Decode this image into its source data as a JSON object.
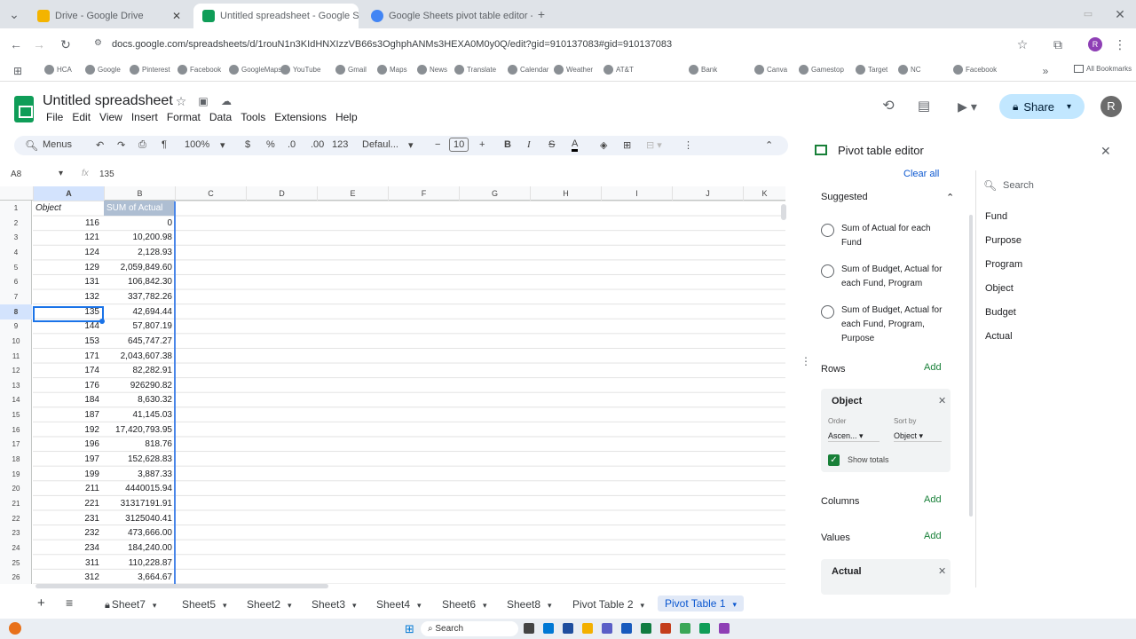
{
  "browser": {
    "tabs": [
      {
        "label": "Drive - Google Drive"
      },
      {
        "label": "Untitled spreadsheet - Google Sheets"
      },
      {
        "label": "Google Sheets pivot table editor - Google Search"
      }
    ],
    "url": "docs.google.com/spreadsheets/d/1rouN1n3KIdHNXIzzVB66s3OghphANMs3HEXA0M0y0Q/edit?gid=910137083#gid=910137083",
    "bookmarks": [
      "HCA",
      "Google",
      "Pinterest",
      "Facebook",
      "GoogleMaps",
      "YouTube",
      "Gmail",
      "Maps",
      "News",
      "Translate",
      "Calendar",
      "Weather",
      "AT&T",
      "Bank",
      "Canva",
      "Gamestop",
      "Target",
      "NC",
      "Facebook"
    ],
    "all_bookmarks": "All Bookmarks"
  },
  "doc": {
    "title": "Untitled spreadsheet",
    "menus": [
      "File",
      "Edit",
      "View",
      "Insert",
      "Format",
      "Data",
      "Tools",
      "Extensions",
      "Help"
    ],
    "share_label": "Share",
    "avatar": "R"
  },
  "toolbar": {
    "menus_label": "Menus",
    "zoom": "100%",
    "currency": "$",
    "percent": "%",
    "dec_decrease": ".0",
    "dec_increase": ".00",
    "number_format": "123",
    "font": "Defaul...",
    "font_size": "10",
    "bold": "B",
    "italic": "I"
  },
  "formula": {
    "cell_ref": "A8",
    "value": "135"
  },
  "columns": [
    "A",
    "B",
    "C",
    "D",
    "E",
    "F",
    "G",
    "H",
    "I",
    "J",
    "K"
  ],
  "rows": [
    {
      "n": "1",
      "a": "Object",
      "b": "SUM of Actual"
    },
    {
      "n": "2",
      "a": "116",
      "b": "0"
    },
    {
      "n": "3",
      "a": "121",
      "b": "10,200.98"
    },
    {
      "n": "4",
      "a": "124",
      "b": "2,128.93"
    },
    {
      "n": "5",
      "a": "129",
      "b": "2,059,849.60"
    },
    {
      "n": "6",
      "a": "131",
      "b": "106,842.30"
    },
    {
      "n": "7",
      "a": "132",
      "b": "337,782.26"
    },
    {
      "n": "8",
      "a": "135",
      "b": "42,694.44"
    },
    {
      "n": "9",
      "a": "144",
      "b": "57,807.19"
    },
    {
      "n": "10",
      "a": "153",
      "b": "645,747.27"
    },
    {
      "n": "11",
      "a": "171",
      "b": "2,043,607.38"
    },
    {
      "n": "12",
      "a": "174",
      "b": "82,282.91"
    },
    {
      "n": "13",
      "a": "176",
      "b": "926290.82"
    },
    {
      "n": "14",
      "a": "184",
      "b": "8,630.32"
    },
    {
      "n": "15",
      "a": "187",
      "b": "41,145.03"
    },
    {
      "n": "16",
      "a": "192",
      "b": "17,420,793.95"
    },
    {
      "n": "17",
      "a": "196",
      "b": "818.76"
    },
    {
      "n": "18",
      "a": "197",
      "b": "152,628.83"
    },
    {
      "n": "19",
      "a": "199",
      "b": "3,887.33"
    },
    {
      "n": "20",
      "a": "211",
      "b": "4440015.94"
    },
    {
      "n": "21",
      "a": "221",
      "b": "31317191.91"
    },
    {
      "n": "22",
      "a": "231",
      "b": "3125040.41"
    },
    {
      "n": "23",
      "a": "232",
      "b": "473,666.00"
    },
    {
      "n": "24",
      "a": "234",
      "b": "184,240.00"
    },
    {
      "n": "25",
      "a": "311",
      "b": "110,228.87"
    },
    {
      "n": "26",
      "a": "312",
      "b": "3,664.67"
    }
  ],
  "sheets": [
    "Sheet7",
    "Sheet5",
    "Sheet2",
    "Sheet3",
    "Sheet4",
    "Sheet6",
    "Sheet8",
    "Pivot Table 2",
    "Pivot Table 1"
  ],
  "pivot": {
    "title": "Pivot table editor",
    "clear_all": "Clear all",
    "suggested": "Suggested",
    "suggestions": [
      "Sum of Actual for each Fund",
      "Sum of Budget, Actual for each Fund, Program",
      "Sum of Budget, Actual for each Fund, Program, Purpose"
    ],
    "rows_label": "Rows",
    "add": "Add",
    "row_field": "Object",
    "order_label": "Order",
    "order_value": "Ascen...",
    "sort_by_label": "Sort by",
    "sort_by_value": "Object",
    "show_totals": "Show totals",
    "columns_label": "Columns",
    "values_label": "Values",
    "value_field": "Actual",
    "search_placeholder": "Search",
    "fields": [
      "Fund",
      "Purpose",
      "Program",
      "Object",
      "Budget",
      "Actual"
    ]
  },
  "taskbar": {
    "search": "Search"
  }
}
